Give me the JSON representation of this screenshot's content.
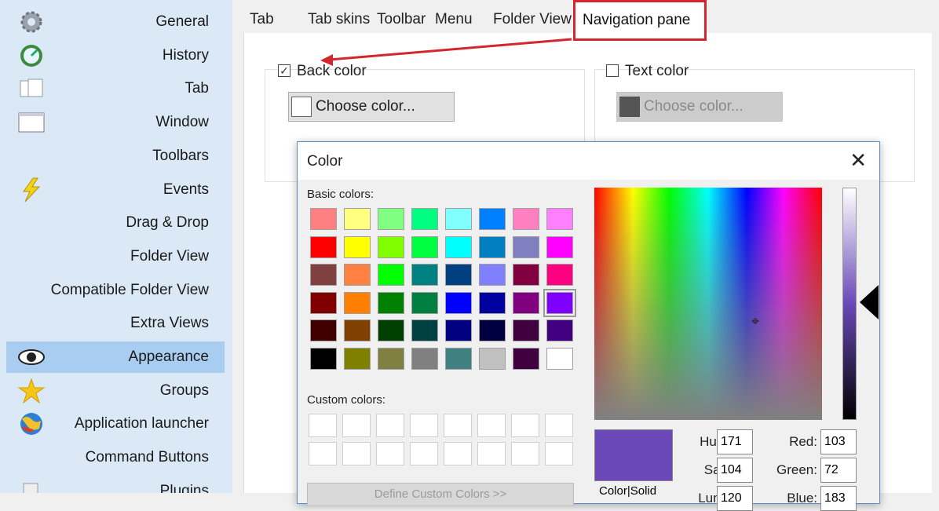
{
  "sidebar": {
    "items": [
      {
        "label": "General",
        "icon": "gear-icon"
      },
      {
        "label": "History",
        "icon": "clock-icon"
      },
      {
        "label": "Tab",
        "icon": "tab-icon"
      },
      {
        "label": "Window",
        "icon": "window-icon"
      },
      {
        "label": "Toolbars",
        "icon": "toolbar-icon"
      },
      {
        "label": "Events",
        "icon": "lightning-icon"
      },
      {
        "label": "Drag & Drop",
        "icon": ""
      },
      {
        "label": "Folder View",
        "icon": ""
      },
      {
        "label": "Compatible Folder View",
        "icon": ""
      },
      {
        "label": "Extra Views",
        "icon": ""
      },
      {
        "label": "Appearance",
        "icon": "eye-icon",
        "selected": true
      },
      {
        "label": "Groups",
        "icon": "star-icon"
      },
      {
        "label": "Application launcher",
        "icon": "globe-icon"
      },
      {
        "label": "Command Buttons",
        "icon": ""
      },
      {
        "label": "Plugins",
        "icon": "plugin-icon"
      }
    ]
  },
  "tabs": [
    "Tab",
    "Tab skins",
    "Toolbar",
    "Menu",
    "Folder View",
    "Navigation pane"
  ],
  "active_tab": "Navigation pane",
  "back_color": {
    "label": "Back color",
    "checked": true,
    "button_label": "Choose color...",
    "swatch_color": "#ffffff"
  },
  "text_color": {
    "label": "Text color",
    "checked": false,
    "button_label": "Choose color...",
    "swatch_color": "#555555"
  },
  "annotation_color": "#d3262e",
  "color_dialog": {
    "title": "Color",
    "basic_colors_label": "Basic colors:",
    "custom_colors_label": "Custom colors:",
    "define_button_label": "Define Custom Colors >>",
    "basic_colors": [
      [
        "#ff8080",
        "#ffff80",
        "#80ff80",
        "#00ff80",
        "#80ffff",
        "#0080ff",
        "#ff80c0",
        "#ff80ff"
      ],
      [
        "#ff0000",
        "#ffff00",
        "#80ff00",
        "#00ff40",
        "#00ffff",
        "#0080c0",
        "#8080c0",
        "#ff00ff"
      ],
      [
        "#804040",
        "#ff8040",
        "#00ff00",
        "#008080",
        "#004080",
        "#8080ff",
        "#800040",
        "#ff0080"
      ],
      [
        "#800000",
        "#ff8000",
        "#008000",
        "#008040",
        "#0000ff",
        "#0000a0",
        "#800080",
        "#8000ff"
      ],
      [
        "#400000",
        "#804000",
        "#004000",
        "#004040",
        "#000080",
        "#000040",
        "#400040",
        "#400080"
      ],
      [
        "#000000",
        "#808000",
        "#808040",
        "#808080",
        "#408080",
        "#c0c0c0",
        "#400040",
        "#ffffff"
      ]
    ],
    "selected_basic": "#8000ff",
    "preview_color": "#6a48b8",
    "preview_label": "Color|Solid",
    "fields": {
      "hue": {
        "label": "Hue:",
        "value": "171"
      },
      "sat": {
        "label": "Sat:",
        "value": "104"
      },
      "lum": {
        "label": "Lum:",
        "value": "120"
      },
      "red": {
        "label": "Red:",
        "value": "103"
      },
      "green": {
        "label": "Green:",
        "value": "72"
      },
      "blue": {
        "label": "Blue:",
        "value": "183"
      }
    }
  }
}
